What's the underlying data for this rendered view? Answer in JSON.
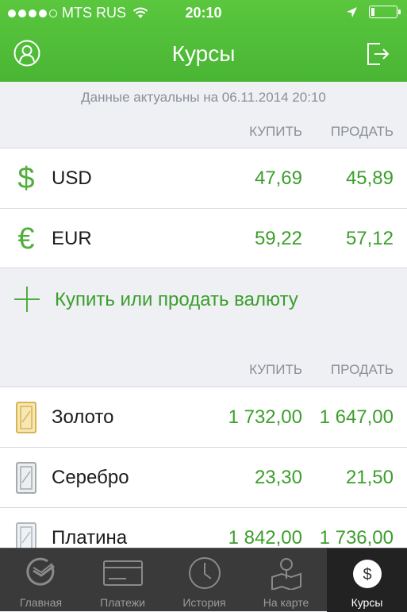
{
  "status_bar": {
    "carrier": "MTS RUS",
    "time": "20:10",
    "signal_bars_filled": 4,
    "signal_bars_total": 5,
    "battery_level": 0.15
  },
  "header": {
    "title": "Курсы"
  },
  "updated_text": "Данные актуальны на 06.11.2014 20:10",
  "currency_section": {
    "col_buy": "КУПИТЬ",
    "col_sell": "ПРОДАТЬ",
    "rows": [
      {
        "icon": "dollar-icon",
        "symbol": "$",
        "name": "USD",
        "buy": "47,69",
        "sell": "45,89"
      },
      {
        "icon": "euro-icon",
        "symbol": "€",
        "name": "EUR",
        "buy": "59,22",
        "sell": "57,12"
      }
    ],
    "action_label": "Купить или продать валюту"
  },
  "metals_section": {
    "col_buy": "КУПИТЬ",
    "col_sell": "ПРОДАТЬ",
    "rows": [
      {
        "icon": "gold-bar-icon",
        "name": "Золото",
        "buy": "1 732,00",
        "sell": "1 647,00",
        "color": "#e8c45a"
      },
      {
        "icon": "silver-bar-icon",
        "name": "Серебро",
        "buy": "23,30",
        "sell": "21,50",
        "color": "#b8bcc0"
      },
      {
        "icon": "platinum-bar-icon",
        "name": "Платина",
        "buy": "1 842,00",
        "sell": "1 736,00",
        "color": "#c8d0d6"
      }
    ]
  },
  "tabbar": {
    "tabs": [
      {
        "label": "Главная",
        "icon": "sber-logo-icon"
      },
      {
        "label": "Платежи",
        "icon": "card-icon"
      },
      {
        "label": "История",
        "icon": "clock-icon"
      },
      {
        "label": "На карте",
        "icon": "map-pin-icon"
      },
      {
        "label": "Курсы",
        "icon": "dollar-coin-icon",
        "symbol": "$",
        "active": true
      }
    ]
  },
  "colors": {
    "brand_green": "#4fb836",
    "value_green": "#3c9e2c",
    "tabbar_bg": "#3a3a3a"
  }
}
